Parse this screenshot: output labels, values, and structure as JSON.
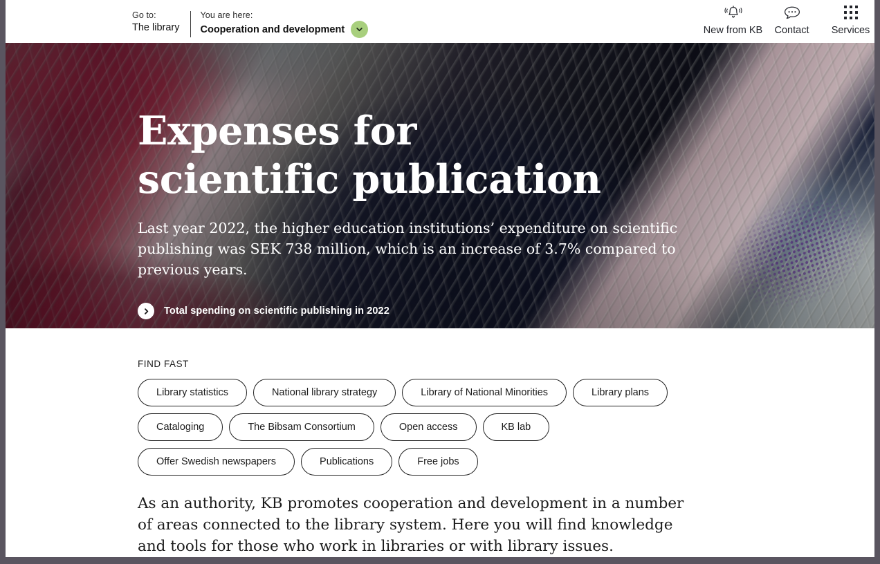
{
  "header": {
    "breadcrumb": {
      "goto_kicker": "Go to:",
      "goto_value": "The library",
      "here_kicker": "You are here:",
      "here_value": "Cooperation and development",
      "chevron_icon": "chevron-down-icon",
      "chevron_bg": "#a8cf7d"
    },
    "utilities": [
      {
        "label": "New from KB",
        "icon": "bell-icon"
      },
      {
        "label": "Contact",
        "icon": "speech-bubble-icon"
      },
      {
        "label": "Services",
        "icon": "grid-apps-icon"
      }
    ]
  },
  "hero": {
    "title": "Expenses for scientific publication",
    "subtitle": "Last year 2022, the higher education institutions’ expenditure on scientific publishing was SEK 738 million, which is an increase of 3.7% compared to previous years.",
    "cta_label": "Total spending on scientific publishing in 2022",
    "cta_icon": "chevron-right-circle-icon"
  },
  "find_fast": {
    "label": "FIND FAST",
    "pills": [
      "Library statistics",
      "National library strategy",
      "Library of National Minorities",
      "Library plans",
      "Cataloging",
      "The Bibsam Consortium",
      "Open access",
      "KB lab",
      "Offer Swedish newspapers",
      "Publications",
      "Free jobs"
    ]
  },
  "intro": {
    "paragraph": "As an authority, KB promotes cooperation and development in a number of areas connected to the library system. Here you will find knowledge and tools for those who work in libraries or with library issues."
  }
}
